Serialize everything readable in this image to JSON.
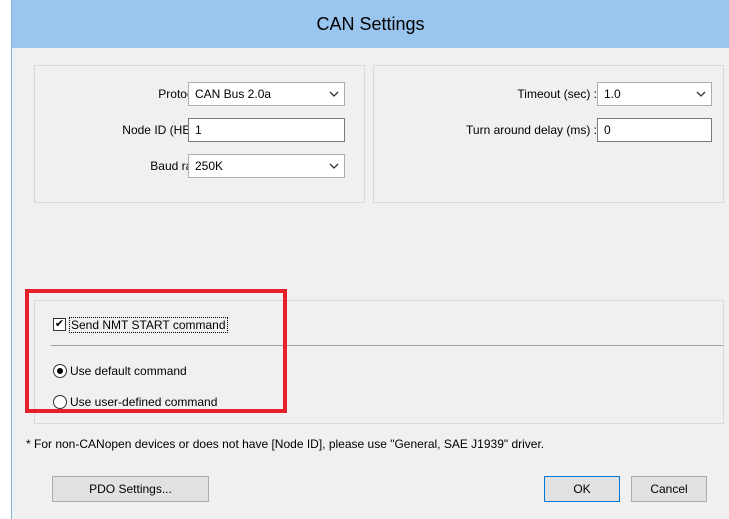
{
  "window": {
    "title": "CAN Settings"
  },
  "left_group": {
    "protocol": {
      "label": "Protocol :",
      "value": "CAN Bus 2.0a"
    },
    "node_id": {
      "label": "Node ID (HEX) :",
      "value": "1"
    },
    "baud_rate": {
      "label": "Baud rate :",
      "value": "250K"
    }
  },
  "right_group": {
    "timeout": {
      "label": "Timeout (sec) :",
      "value": "1.0"
    },
    "turnaround": {
      "label": "Turn around delay (ms) :",
      "value": "0"
    }
  },
  "nmt_group": {
    "send_nmt": {
      "label": "Send NMT START command",
      "checked": true
    },
    "default_cmd": {
      "label": "Use default command",
      "selected": true
    },
    "user_cmd": {
      "label": "Use user-defined command",
      "selected": false
    }
  },
  "note": "* For non-CANopen devices or does not have [Node ID], please use \"General, SAE J1939\" driver.",
  "buttons": {
    "pdo_settings": "PDO Settings...",
    "ok": "OK",
    "cancel": "Cancel"
  },
  "icons": {
    "chevron": "chevron-down-icon",
    "check": "✔"
  },
  "colors": {
    "titlebar": "#99c5ee",
    "highlight": "#e8202a"
  }
}
